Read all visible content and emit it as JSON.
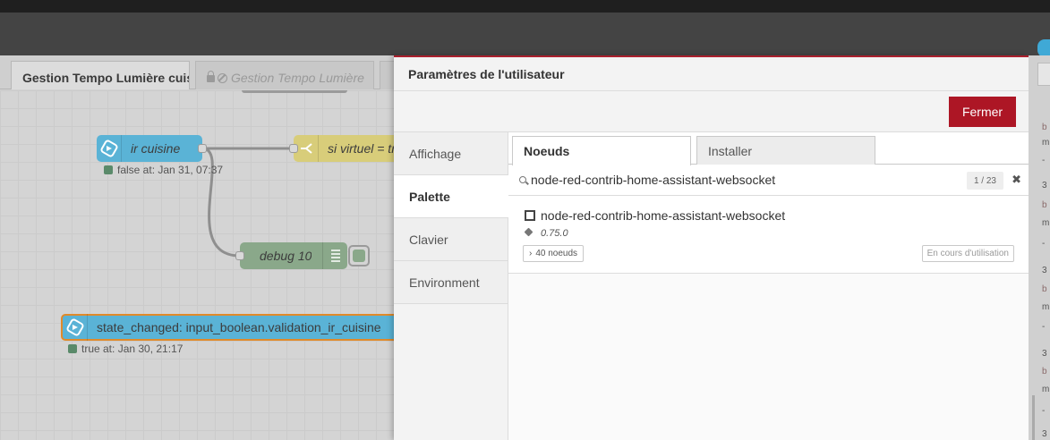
{
  "workspace": {
    "tabs": [
      {
        "label": "Gestion Tempo Lumière cuisine"
      },
      {
        "label": "Gestion Tempo Lumière"
      }
    ],
    "nodes": {
      "ir_cuisine": {
        "label": "ir cuisine",
        "status": "false at: Jan 31, 07:37"
      },
      "switch": {
        "label": "si virtuel = true"
      },
      "debug": {
        "label": "debug 10"
      },
      "state_changed": {
        "label": "state_changed: input_boolean.validation_ir_cuisine",
        "status": "true at: Jan 30, 21:17"
      }
    }
  },
  "dialog": {
    "title": "Paramètres de l'utilisateur",
    "close_label": "Fermer",
    "nav": [
      {
        "label": "Affichage"
      },
      {
        "label": "Palette"
      },
      {
        "label": "Clavier"
      },
      {
        "label": "Environment"
      }
    ],
    "tabs": [
      {
        "label": "Noeuds"
      },
      {
        "label": "Installer"
      }
    ],
    "search": {
      "value": "node-red-contrib-home-assistant-websocket",
      "count": "1 / 23"
    },
    "result": {
      "name": "node-red-contrib-home-assistant-websocket",
      "version": "0.75.0",
      "nodes_label": "40 noeuds",
      "status_label": "En cours d'utilisation"
    }
  },
  "right_log": [
    {
      "text": "b"
    },
    {
      "text": "m"
    },
    {
      "text": "-"
    },
    {
      "text": "3"
    },
    {
      "text": "b"
    },
    {
      "text": "m"
    },
    {
      "text": "-"
    },
    {
      "text": "3"
    },
    {
      "text": "b"
    },
    {
      "text": "m"
    },
    {
      "text": "-"
    },
    {
      "text": "3"
    },
    {
      "text": "b"
    },
    {
      "text": "m"
    },
    {
      "text": "-"
    },
    {
      "text": "3"
    }
  ],
  "colors": {
    "accent_red": "#ad1625",
    "inject_blue": "#5ab3d6",
    "switch_yellow": "#d8cd7a",
    "debug_green": "#8aa88a"
  }
}
